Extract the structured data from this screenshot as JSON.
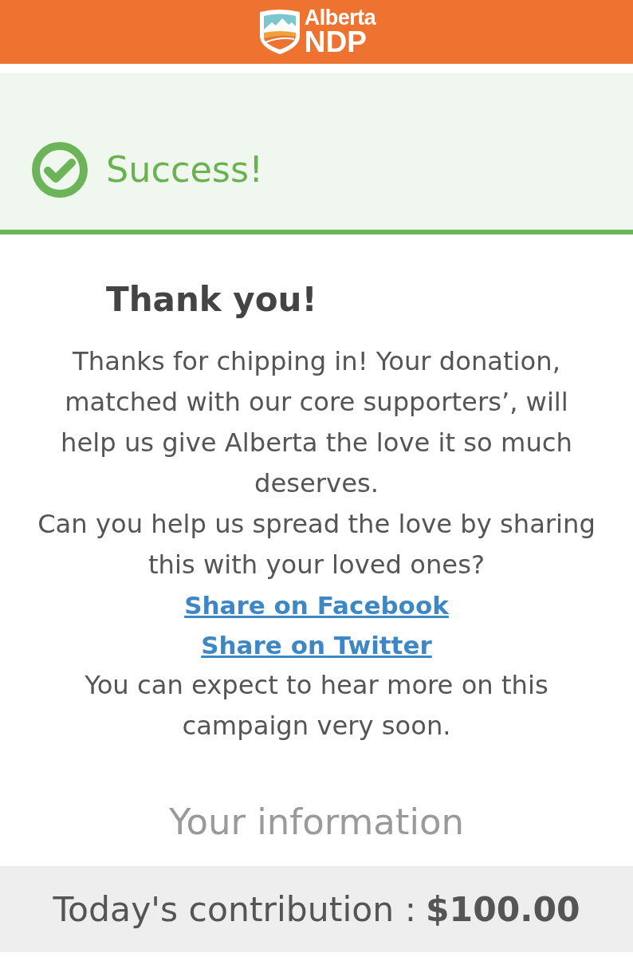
{
  "header": {
    "logo": {
      "line_1": "Alberta",
      "line_2": "NDP"
    }
  },
  "alert": {
    "kind": "success",
    "title": "Success!"
  },
  "thank_you": {
    "heading": "Thank you!",
    "body": [
      {
        "kind": "text",
        "text": "Thanks for chipping in! Your donation, matched with our core supporters’, will help us give Alberta the love it so much deserves."
      },
      {
        "kind": "text",
        "text": "Can you help us spread the love by sharing this with your loved ones?"
      },
      {
        "kind": "link",
        "text": "Share on Facebook"
      },
      {
        "kind": "link",
        "text": "Share on Twitter"
      },
      {
        "kind": "text",
        "text": "You can expect to hear more on this campaign very soon."
      }
    ]
  },
  "your_information": {
    "heading": "Your information"
  },
  "contribution": {
    "label": "Today's contribution :",
    "amount": "$100.00"
  }
}
